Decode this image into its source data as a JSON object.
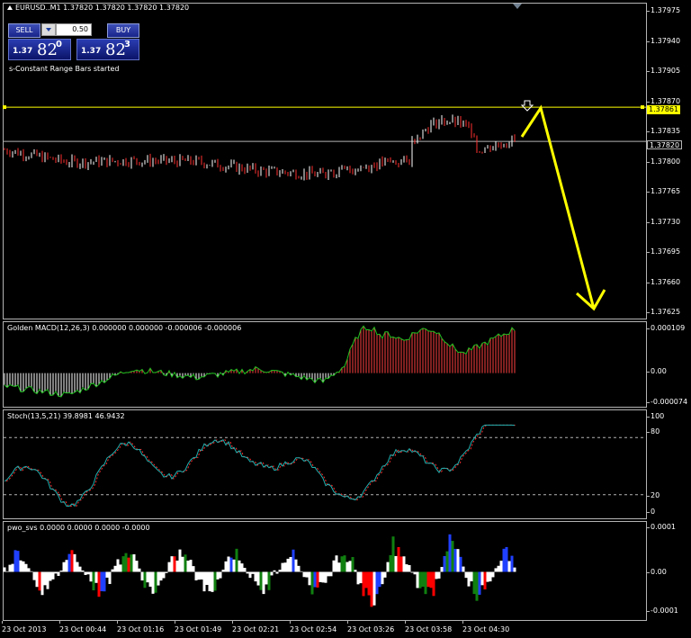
{
  "colors": {
    "bull": "#ffffff",
    "bear": "#ff3030",
    "hline_yellow": "#ffff00",
    "hline_gray": "#b4b4b4",
    "macd_pos": "#ff4040",
    "macd_neg": "#20c020",
    "macd_line": "#20c020",
    "stoch_main": "#20b0b0",
    "stoch_signal": "#ff3030",
    "pwo_white": "#ffffff",
    "pwo_red": "#ff0000",
    "pwo_blue": "#2040ff",
    "pwo_green": "#108010",
    "arrow": "#ffff00"
  },
  "title_bar": {
    "symbol_line": "EURUSD..M1  1.37820 1.37820 1.37820 1.37820"
  },
  "trade_panel": {
    "sell_label": "SELL",
    "buy_label": "BUY",
    "lot_value": "0.50",
    "sell_small": "1.37",
    "sell_big": "82",
    "sell_sup": "0",
    "buy_small": "1.37",
    "buy_big": "82",
    "buy_sup": "3"
  },
  "status_text": "s-Constant Range Bars started",
  "price_labels": {
    "yellow_line": "1.37861",
    "bid_line": "1.37820"
  },
  "main_axis": {
    "ticks": [
      "1.37975",
      "1.37940",
      "1.37905",
      "1.37870",
      "1.37835",
      "1.37800",
      "1.37765",
      "1.37730",
      "1.37695",
      "1.37660",
      "1.37625"
    ]
  },
  "macd": {
    "title": "Golden MACD(12,26,3) 0.000000 0.000000 -0.000006 -0.000006",
    "ticks": [
      "0.000109",
      "0.00",
      "-0.000074"
    ]
  },
  "stoch": {
    "title": "Stoch(13,5,21) 39.8981 46.9432",
    "ticks": [
      "100",
      "80",
      "20",
      "0"
    ]
  },
  "pwo": {
    "title": "pwo_svs 0.0000 0.0000 0.0000 -0.0000",
    "ticks": [
      "0.0001",
      "0.00",
      "-0.0001"
    ]
  },
  "x_axis": {
    "labels": [
      "23 Oct 2013",
      "23 Oct 00:44",
      "23 Oct 01:16",
      "23 Oct 01:49",
      "23 Oct 02:21",
      "23 Oct 02:54",
      "23 Oct 03:26",
      "23 Oct 03:58",
      "23 Oct 04:30"
    ]
  },
  "chart_data": {
    "type": "line",
    "title": "EURUSD..M1",
    "x": [
      "23 Oct 2013",
      "23 Oct 00:44",
      "23 Oct 01:16",
      "23 Oct 01:49",
      "23 Oct 02:21",
      "23 Oct 02:54",
      "23 Oct 03:26",
      "23 Oct 03:58",
      "23 Oct 04:30"
    ],
    "series": [
      {
        "name": "EURUSD..M1",
        "values": [
          1.3781,
          1.37795,
          1.37797,
          1.37796,
          1.37785,
          1.3778,
          1.37795,
          1.378,
          1.37822
        ]
      }
    ],
    "ylim": [
      1.3761,
      1.37985
    ],
    "hlines": [
      1.37861,
      1.3782
    ],
    "indicators": {
      "macd": {
        "values": [
          -3e-05,
          -5e-05,
          1e-05,
          -1e-05,
          1e-05,
          -2e-05,
          9e-05,
          3e-05,
          0.0001
        ],
        "ylim": [
          -7.4e-05,
          0.000109
        ]
      },
      "stoch": {
        "values": [
          35,
          25,
          60,
          55,
          70,
          25,
          45,
          65,
          90
        ],
        "ylim": [
          0,
          100
        ],
        "levels": [
          80,
          20
        ]
      },
      "pwo": {
        "values": [
          -2e-05,
          2e-05,
          3e-05,
          -1e-05,
          2e-05,
          1e-05,
          6e-05,
          4e-05,
          7e-05
        ],
        "ylim": [
          -0.0001,
          0.0001
        ]
      }
    }
  }
}
